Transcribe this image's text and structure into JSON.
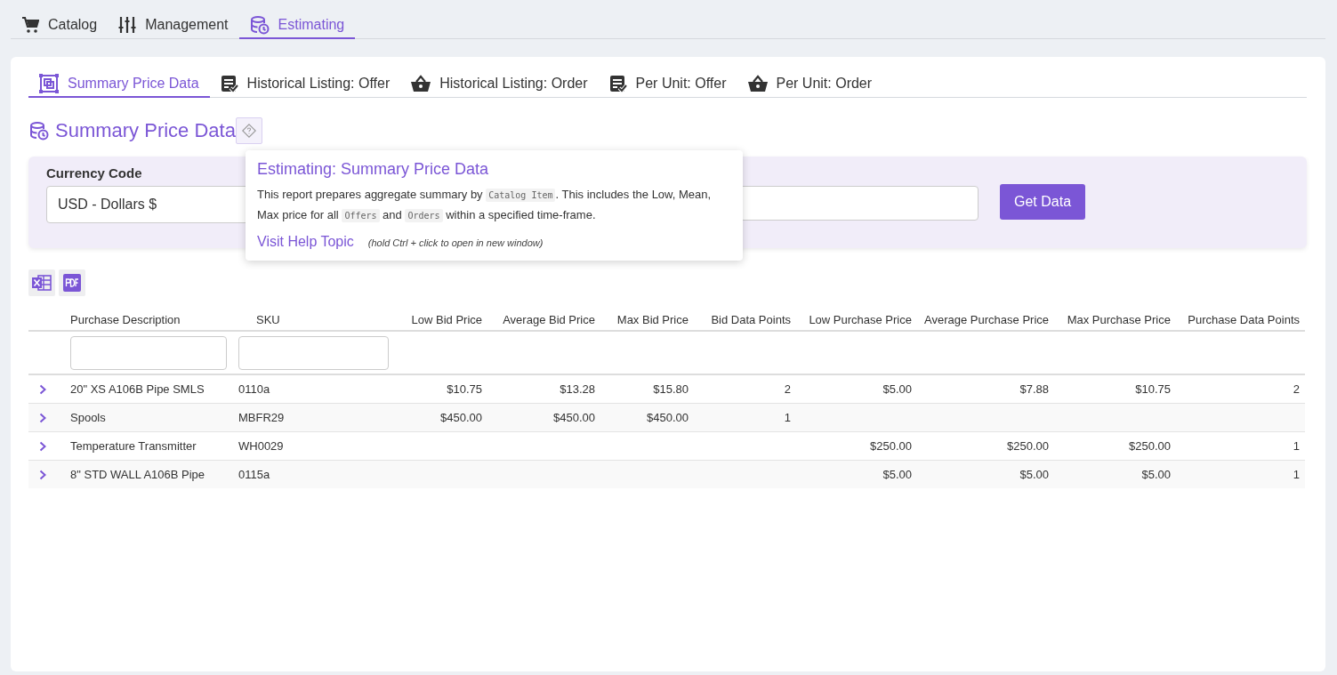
{
  "top_tabs": [
    {
      "label": "Catalog",
      "selected": false
    },
    {
      "label": "Management",
      "selected": false
    },
    {
      "label": "Estimating",
      "selected": true
    }
  ],
  "report_tabs": [
    {
      "label": "Summary Price Data",
      "selected": true
    },
    {
      "label": "Historical Listing: Offer",
      "selected": false
    },
    {
      "label": "Historical Listing: Order",
      "selected": false
    },
    {
      "label": "Per Unit: Offer",
      "selected": false
    },
    {
      "label": "Per Unit: Order",
      "selected": false
    }
  ],
  "page_title": "Summary Price Data",
  "help_popover": {
    "title": "Estimating: Summary Price Data",
    "description": [
      {
        "kind": "text",
        "text": "This report prepares aggregate summary by "
      },
      {
        "kind": "code",
        "text": "Catalog Item"
      },
      {
        "kind": "text",
        "text": ". This includes the Low, Mean, Max price for all "
      },
      {
        "kind": "code",
        "text": "Offers"
      },
      {
        "kind": "text",
        "text": " and "
      },
      {
        "kind": "code",
        "text": "Orders"
      },
      {
        "kind": "text",
        "text": " within a specified time-frame."
      }
    ],
    "link": "Visit Help Topic",
    "hint": "(hold Ctrl + click to open in new window)"
  },
  "filters": {
    "currency_label": "Currency Code",
    "currency_value": "USD - Dollars $",
    "button": "Get Data"
  },
  "table": {
    "columns": [
      {
        "label": "Purchase Description",
        "filter": true
      },
      {
        "label": "SKU",
        "filter": true
      },
      {
        "label": "Low Bid Price",
        "filter": false
      },
      {
        "label": "Average Bid Price",
        "filter": false
      },
      {
        "label": "Max Bid Price",
        "filter": false
      },
      {
        "label": "Bid Data Points",
        "filter": false
      },
      {
        "label": "Low Purchase Price",
        "filter": false
      },
      {
        "label": "Average Purchase Price",
        "filter": false
      },
      {
        "label": "Max Purchase Price",
        "filter": false
      },
      {
        "label": "Purchase Data Points",
        "filter": false
      }
    ],
    "rows": [
      [
        "20\" XS A106B Pipe SMLS",
        "0110a",
        "$10.75",
        "$13.28",
        "$15.80",
        "2",
        "$5.00",
        "$7.88",
        "$10.75",
        "2"
      ],
      [
        "Spools",
        "MBFR29",
        "$450.00",
        "$450.00",
        "$450.00",
        "1",
        "",
        "",
        "",
        ""
      ],
      [
        "Temperature Transmitter",
        "WH0029",
        "",
        "",
        "",
        "",
        "$250.00",
        "$250.00",
        "$250.00",
        "1"
      ],
      [
        "8\" STD WALL A106B Pipe",
        "0115a",
        "",
        "",
        "",
        "",
        "$5.00",
        "$5.00",
        "$5.00",
        "1"
      ]
    ]
  }
}
